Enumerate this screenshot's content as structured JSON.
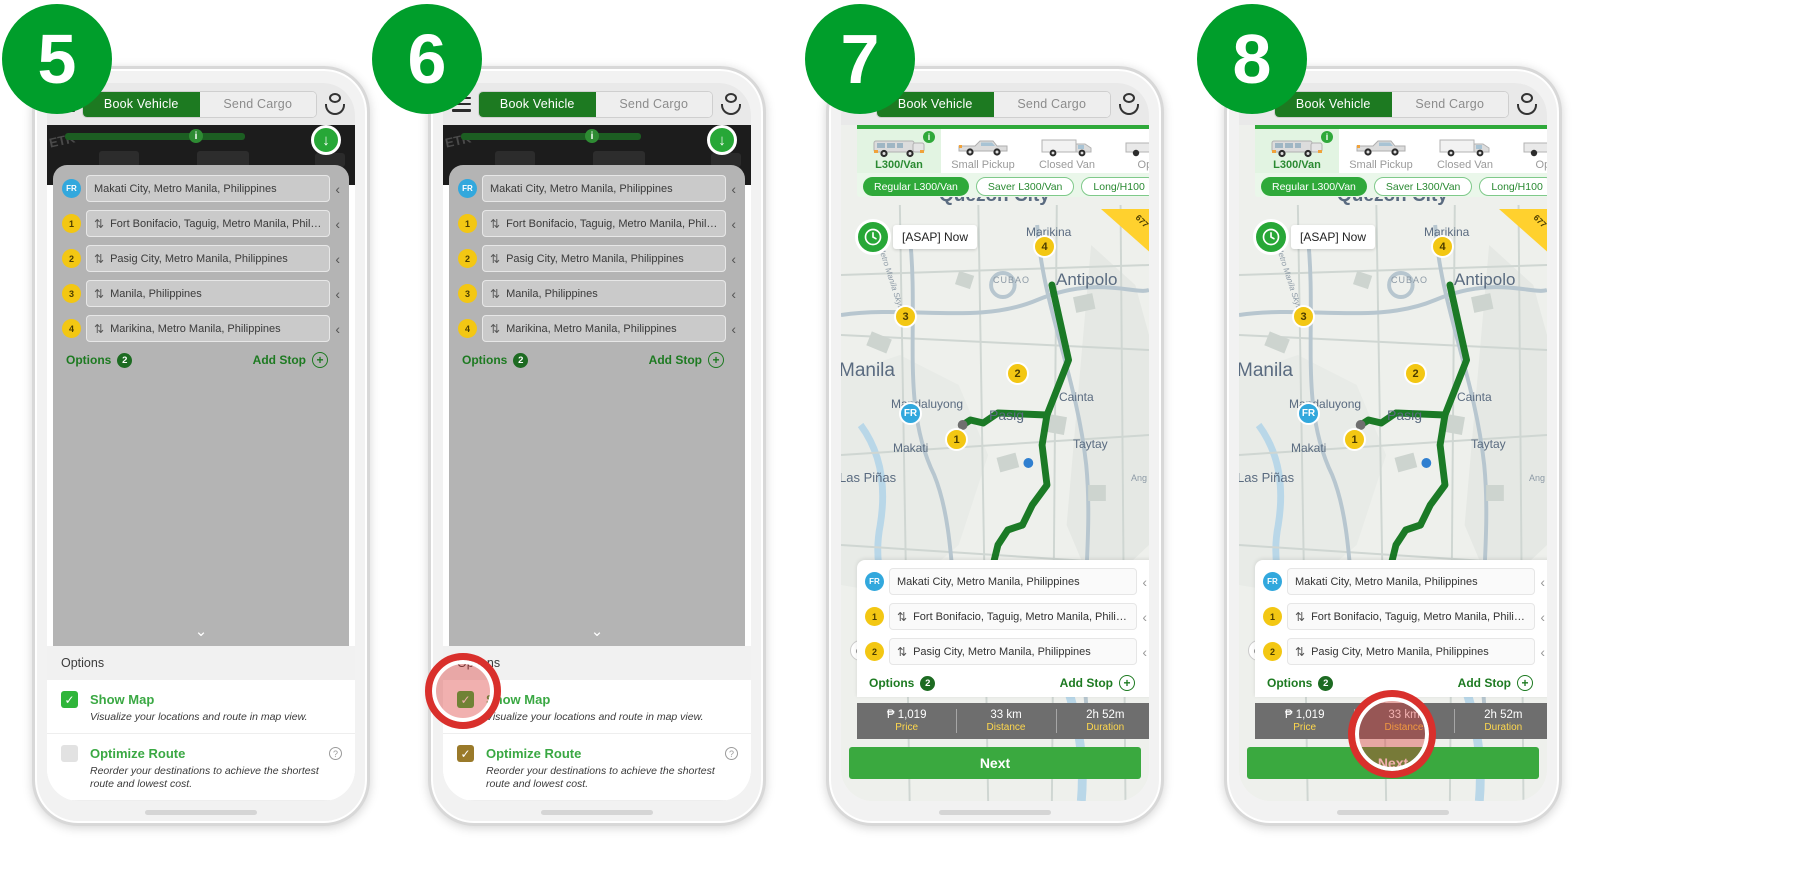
{
  "steps": [
    {
      "number": "5"
    },
    {
      "number": "6"
    },
    {
      "number": "7"
    },
    {
      "number": "8"
    }
  ],
  "header": {
    "menu_icon": "hamburger-icon",
    "tab_book": "Book Vehicle",
    "tab_cargo": "Send Cargo",
    "account_icon": "account-icon"
  },
  "addresses": [
    {
      "badge": "FR",
      "text": "Makati City, Metro Manila, Philippines",
      "sort": false
    },
    {
      "badge": "1",
      "text": "Fort Bonifacio, Taguig, Metro Manila, Philip...",
      "sort": true
    },
    {
      "badge": "2",
      "text": "Pasig City, Metro Manila, Philippines",
      "sort": true
    },
    {
      "badge": "3",
      "text": "Manila, Philippines",
      "sort": true
    },
    {
      "badge": "4",
      "text": "Marikina, Metro Manila, Philippines",
      "sort": true
    }
  ],
  "addresses_short": [
    {
      "badge": "FR",
      "text": "Makati City, Metro Manila, Philippines",
      "sort": false
    },
    {
      "badge": "1",
      "text": "Fort Bonifacio, Taguig, Metro Manila, Philip...",
      "sort": true
    },
    {
      "badge": "2",
      "text": "Pasig City, Metro Manila, Philippines",
      "sort": true
    }
  ],
  "list_actions": {
    "options_label": "Options",
    "options_count": "2",
    "add_stop_label": "Add Stop",
    "add_icon": "plus-circle-icon"
  },
  "options_panel": {
    "title": "Options",
    "items": [
      {
        "label": "Show Map",
        "description": "Visualize your locations and route in map view.",
        "checked": true,
        "has_help": false
      },
      {
        "label": "Optimize Route",
        "description": "Reorder your destinations to achieve the shortest route and lowest cost.",
        "checked_step5": false,
        "checked_step6": true,
        "has_help": true,
        "help_icon": "question-mark-icon"
      }
    ]
  },
  "vehicles": {
    "tabs": [
      {
        "name": "L300/Van",
        "selected": true,
        "icon": "van-icon"
      },
      {
        "name": "Small Pickup",
        "selected": false,
        "icon": "pickup-icon"
      },
      {
        "name": "Closed Van",
        "selected": false,
        "icon": "closed-van-icon"
      },
      {
        "name": "Open",
        "selected": false,
        "icon": "open-truck-icon"
      }
    ],
    "info_icon": "info-icon",
    "chips": [
      {
        "label": "Regular L300/Van",
        "selected": true
      },
      {
        "label": "Saver L300/Van",
        "selected": false
      },
      {
        "label": "Long/H100",
        "selected": false
      }
    ]
  },
  "map": {
    "clock_icon": "clock-icon",
    "schedule_label": "[ASAP] Now",
    "locate_icon": "crosshair-icon",
    "expand_icon": "arrow-up-icon",
    "corner_badge": "677",
    "labels": [
      "Quezon City",
      "Antipolo",
      "Marikina",
      "CUBAO",
      "Metro Manila Skyway",
      "Manila",
      "Mandaluyong",
      "Pasig",
      "Cainta",
      "Taytay",
      "Makati",
      "Las Piñas",
      "Ang"
    ],
    "stop_markers": [
      "FR",
      "1",
      "2",
      "3",
      "4"
    ],
    "route_color": "#1b7a26"
  },
  "stats": [
    {
      "value": "₱ 1,019",
      "key": "Price"
    },
    {
      "value": "33 km",
      "key": "Distance"
    },
    {
      "value": "2h 52m",
      "key": "Duration"
    }
  ],
  "next_button": "Next",
  "colors": {
    "brand_green": "#1d7a21",
    "accent_green": "#2fa93a",
    "badge_green": "#009e2b",
    "marker_yellow": "#f3c713",
    "marker_blue": "#32a8dd",
    "stats_bg": "#6e6e6e",
    "stats_key": "#ffd84d",
    "highlight_red": "#d9302c"
  },
  "download_icon": "download-arrow-icon",
  "collapse_icon": "chevron-down-icon",
  "sort_icon": "sort-updown-icon",
  "chevron_left_icon": "chevron-left-icon"
}
